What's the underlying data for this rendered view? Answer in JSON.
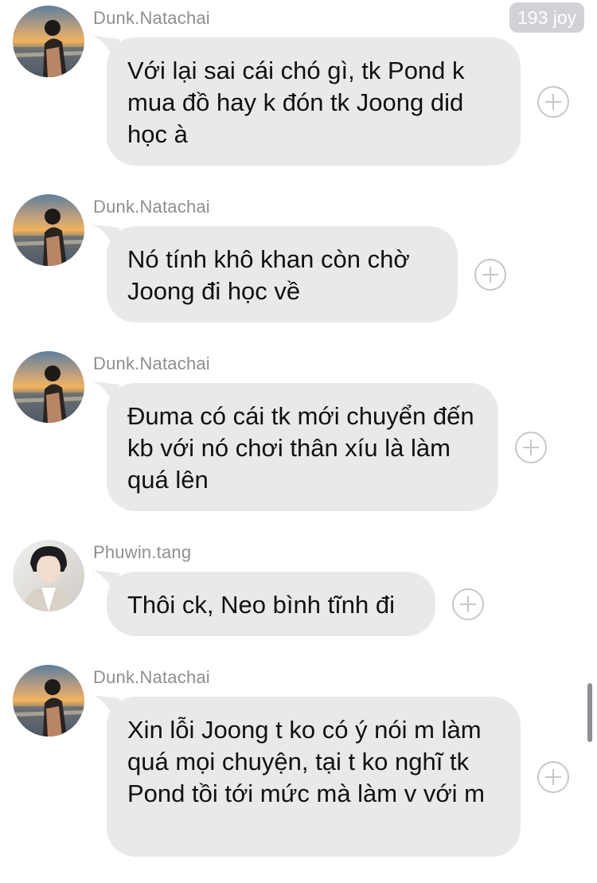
{
  "reaction_badge": "193 joy",
  "messages": [
    {
      "sender": "Dunk.Natachai",
      "avatar": "sunset-avatar",
      "text": "Với lại sai cái chó gì, tk Pond k mua đồ hay k đón tk Joong did học à"
    },
    {
      "sender": "Dunk.Natachai",
      "avatar": "sunset-avatar",
      "text": "Nó tính khô khan còn chờ Joong đi học về"
    },
    {
      "sender": "Dunk.Natachai",
      "avatar": "sunset-avatar",
      "text": "Đuma có cái tk mới chuyển đến kb với nó chơi thân xíu là làm quá lên"
    },
    {
      "sender": "Phuwin.tang",
      "avatar": "portrait-avatar",
      "text": "Thôi ck, Neo bình tĩnh đi"
    },
    {
      "sender": "Dunk.Natachai",
      "avatar": "sunset-avatar",
      "text": "Xin lỗi Joong t ko có ý nói m làm quá mọi chuyện, tại t ko nghĩ tk Pond tồi tới mức mà làm v với m"
    }
  ],
  "colors": {
    "bubble": "#e9e9eb",
    "sender_name": "#8e8e93",
    "add_icon": "#c7c7cc",
    "badge": "#d1d1d6"
  }
}
